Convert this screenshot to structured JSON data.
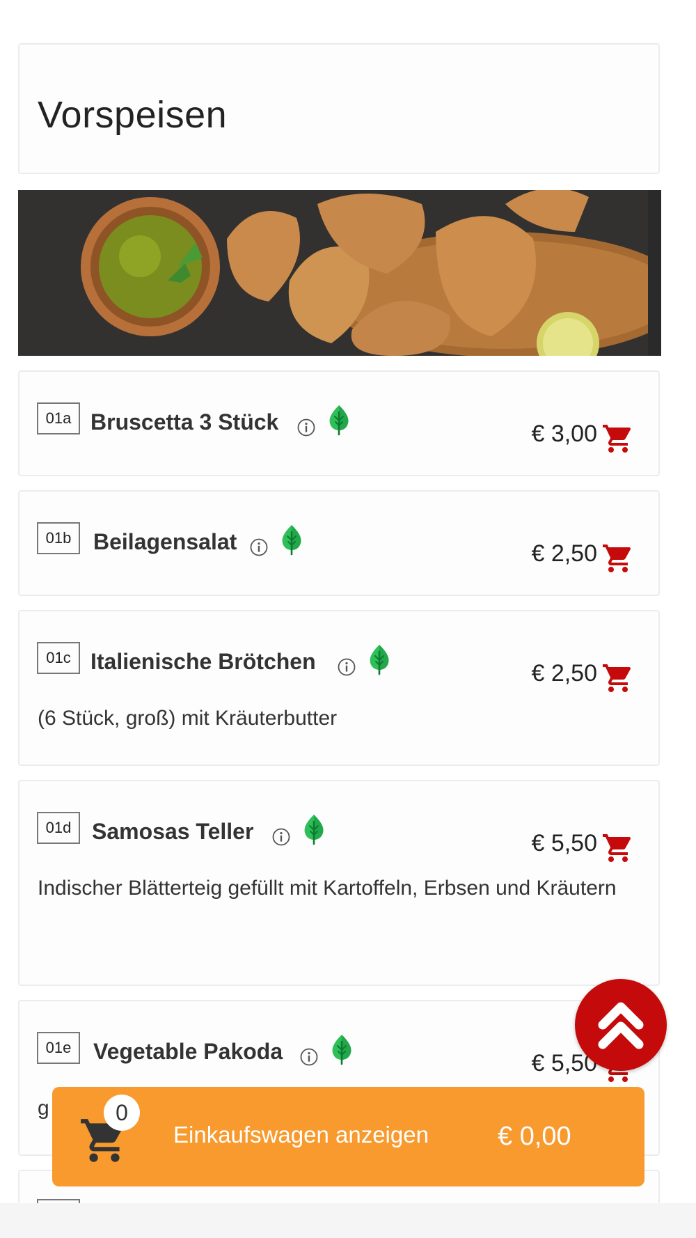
{
  "section": {
    "title": "Vorspeisen"
  },
  "banner": {
    "image": "samosas-with-green-chutney-photo"
  },
  "items": [
    {
      "code": "01a",
      "name": "Bruscetta 3 Stück",
      "price": "€ 3,00",
      "description": "",
      "vegetarian": true
    },
    {
      "code": "01b",
      "name": "Beilagensalat",
      "price": "€ 2,50",
      "description": "",
      "vegetarian": true
    },
    {
      "code": "01c",
      "name": "Italienische Brötchen",
      "price": "€ 2,50",
      "description": "(6 Stück, groß) mit Kräuterbutter",
      "vegetarian": true
    },
    {
      "code": "01d",
      "name": "Samosas Teller",
      "price": "€ 5,50",
      "description": "Indischer Blätterteig gefüllt mit Kartoffeln, Erbsen und Kräutern",
      "vegetarian": true
    },
    {
      "code": "01e",
      "name": "Vegetable Pakoda",
      "price": "€ 5,50",
      "description": "g",
      "vegetarian": true
    }
  ],
  "cart": {
    "count": "0",
    "label": "Einkaufswagen anzeigen",
    "total": "€ 0,00"
  },
  "icons": {
    "info": "info-circle-icon",
    "vegetarian": "leaf-tree-icon",
    "add_to_cart": "shopping-cart-icon",
    "scroll_top": "double-chevron-up-icon"
  },
  "colors": {
    "accent_red": "#c40a0a",
    "cart_bar_orange": "#f89a2d",
    "veg_green": "#2fbf59",
    "cart_icon_dark": "#333333"
  }
}
